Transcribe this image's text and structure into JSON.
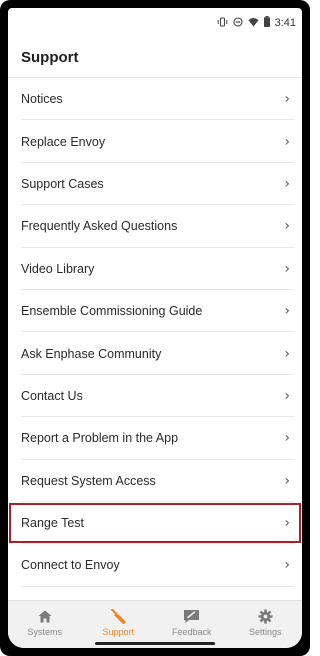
{
  "status_bar": {
    "time": "3:41",
    "icons": [
      "vibrate-icon",
      "dnd-icon",
      "wifi-icon",
      "battery-icon"
    ]
  },
  "header": {
    "title": "Support"
  },
  "menu": {
    "items": [
      {
        "label": "Notices"
      },
      {
        "label": "Replace Envoy"
      },
      {
        "label": "Support Cases"
      },
      {
        "label": "Frequently Asked Questions"
      },
      {
        "label": "Video Library"
      },
      {
        "label": "Ensemble Commissioning Guide"
      },
      {
        "label": "Ask Enphase Community"
      },
      {
        "label": "Contact Us"
      },
      {
        "label": "Report a Problem in the App"
      },
      {
        "label": "Request System Access"
      },
      {
        "label": "Range Test"
      },
      {
        "label": "Connect to Envoy"
      }
    ],
    "highlight_color": "#a4212e"
  },
  "tabbar": {
    "tabs": [
      {
        "label": "Systems",
        "icon": "home-icon",
        "active": false
      },
      {
        "label": "Support",
        "icon": "wrench-icon",
        "active": true
      },
      {
        "label": "Feedback",
        "icon": "feedback-icon",
        "active": false
      },
      {
        "label": "Settings",
        "icon": "gear-icon",
        "active": false
      }
    ],
    "active_color": "#f08526",
    "inactive_color": "#8a8a8a"
  }
}
